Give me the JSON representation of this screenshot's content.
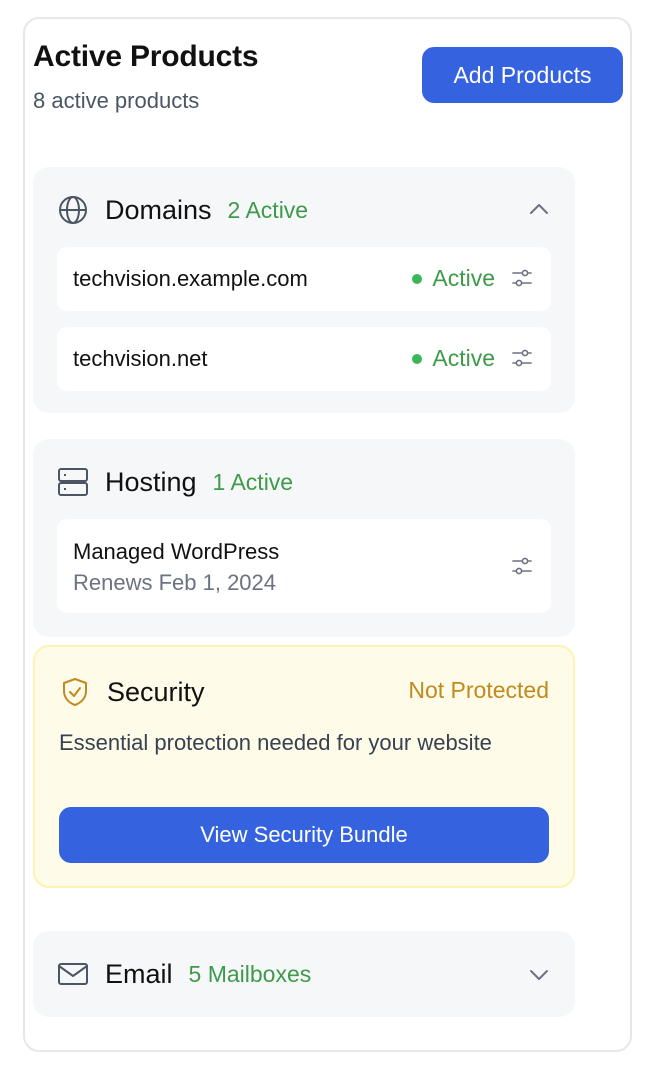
{
  "header": {
    "title": "Active Products",
    "subtitle": "8 active products",
    "add_button": "Add Products"
  },
  "domains": {
    "title": "Domains",
    "count": "2 Active",
    "icon": "globe-icon",
    "expanded": true,
    "items": [
      {
        "name": "techvision.example.com",
        "status": "Active"
      },
      {
        "name": "techvision.net",
        "status": "Active"
      }
    ]
  },
  "hosting": {
    "title": "Hosting",
    "count": "1 Active",
    "icon": "server-icon",
    "items": [
      {
        "name": "Managed WordPress",
        "renews": "Renews Feb 1, 2024"
      }
    ]
  },
  "security": {
    "title": "Security",
    "status": "Not Protected",
    "icon": "shield-check-icon",
    "description": "Essential protection needed for your website",
    "button": "View Security Bundle"
  },
  "email": {
    "title": "Email",
    "count": "5 Mailboxes",
    "icon": "mail-icon",
    "expanded": false
  },
  "colors": {
    "primary": "#3563e0",
    "active_green": "#3f9a4a",
    "warning_amber": "#c08a1e",
    "warning_bg": "#fefce8"
  }
}
